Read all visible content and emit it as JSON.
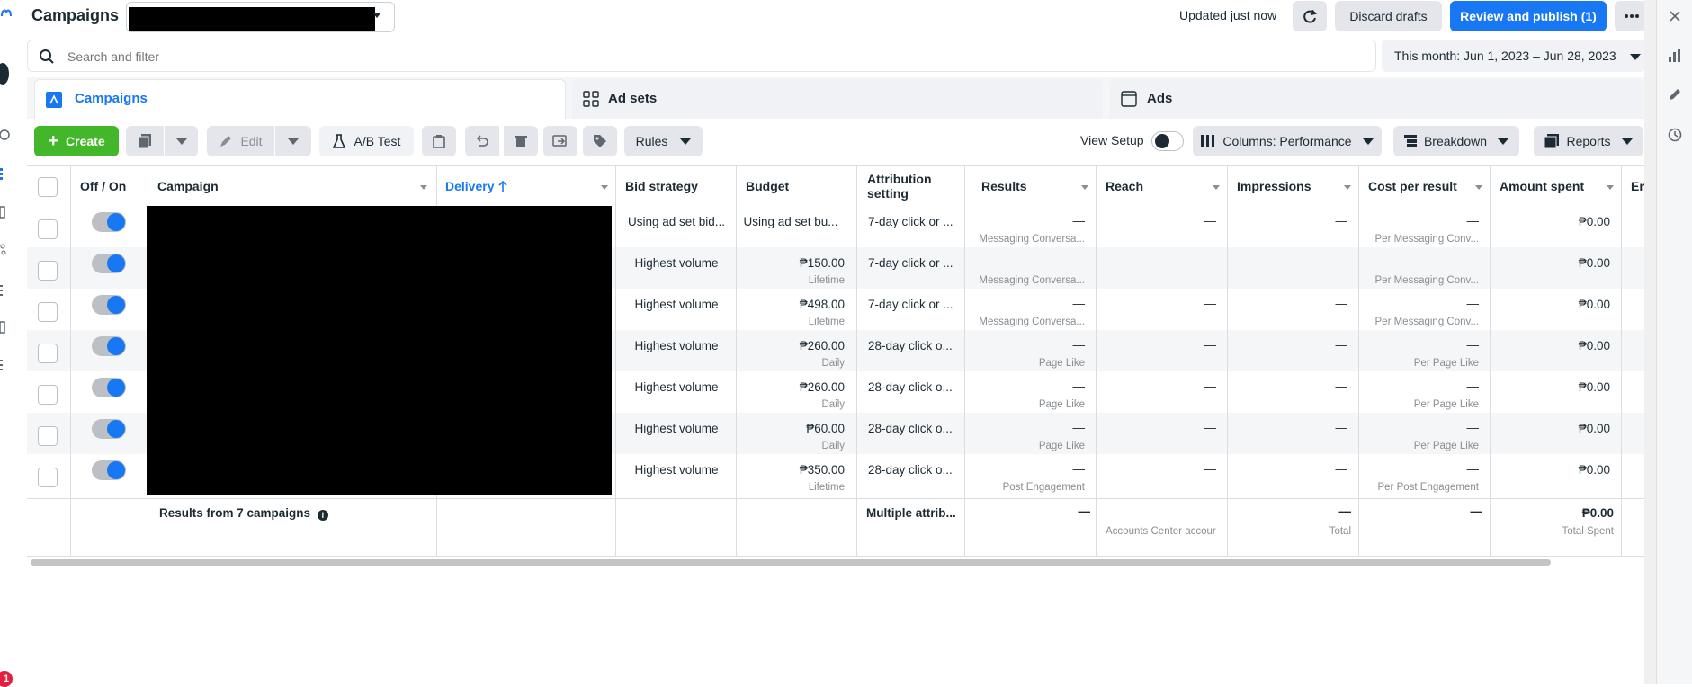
{
  "header": {
    "title": "Campaigns",
    "updated_text": "Updated just now",
    "discard_label": "Discard drafts",
    "publish_label": "Review and publish (1)"
  },
  "search": {
    "placeholder": "Search and filter"
  },
  "date_range": "This month: Jun 1, 2023 – Jun 28, 2023",
  "tabs": [
    {
      "label": "Campaigns",
      "active": true
    },
    {
      "label": "Ad sets",
      "active": false
    },
    {
      "label": "Ads",
      "active": false
    }
  ],
  "toolbar": {
    "create_label": "Create",
    "edit_label": "Edit",
    "ab_test_label": "A/B Test",
    "rules_label": "Rules",
    "view_setup_label": "View Setup",
    "columns_label": "Columns: Performance",
    "breakdown_label": "Breakdown",
    "reports_label": "Reports"
  },
  "columns": {
    "off_on": "Off / On",
    "campaign": "Campaign",
    "delivery": "Delivery",
    "bid_strategy": "Bid strategy",
    "budget": "Budget",
    "attribution": "Attribution setting",
    "results": "Results",
    "reach": "Reach",
    "impressions": "Impressions",
    "cost_per_result": "Cost per result",
    "amount_spent": "Amount spent",
    "ends": "End"
  },
  "rows": [
    {
      "bid": "Using ad set bid...",
      "budget": "Using ad set bu...",
      "budget_sub": "",
      "attribution": "7-day click or ...",
      "results": "—",
      "results_sub": "Messaging Conversa...",
      "reach": "—",
      "impressions": "—",
      "cpr": "—",
      "cpr_sub": "Per Messaging Conv...",
      "spent": "₱0.00"
    },
    {
      "bid": "Highest volume",
      "budget": "₱150.00",
      "budget_sub": "Lifetime",
      "attribution": "7-day click or ...",
      "results": "—",
      "results_sub": "Messaging Conversa...",
      "reach": "—",
      "impressions": "—",
      "cpr": "—",
      "cpr_sub": "Per Messaging Conv...",
      "spent": "₱0.00"
    },
    {
      "bid": "Highest volume",
      "budget": "₱498.00",
      "budget_sub": "Lifetime",
      "attribution": "7-day click or ...",
      "results": "—",
      "results_sub": "Messaging Conversa...",
      "reach": "—",
      "impressions": "—",
      "cpr": "—",
      "cpr_sub": "Per Messaging Conv...",
      "spent": "₱0.00"
    },
    {
      "bid": "Highest volume",
      "budget": "₱260.00",
      "budget_sub": "Daily",
      "attribution": "28-day click o...",
      "results": "—",
      "results_sub": "Page Like",
      "reach": "—",
      "impressions": "—",
      "cpr": "—",
      "cpr_sub": "Per Page Like",
      "spent": "₱0.00"
    },
    {
      "bid": "Highest volume",
      "budget": "₱260.00",
      "budget_sub": "Daily",
      "attribution": "28-day click o...",
      "results": "—",
      "results_sub": "Page Like",
      "reach": "—",
      "impressions": "—",
      "cpr": "—",
      "cpr_sub": "Per Page Like",
      "spent": "₱0.00"
    },
    {
      "bid": "Highest volume",
      "budget": "₱60.00",
      "budget_sub": "Daily",
      "attribution": "28-day click o...",
      "results": "—",
      "results_sub": "Page Like",
      "reach": "—",
      "impressions": "—",
      "cpr": "—",
      "cpr_sub": "Per Page Like",
      "spent": "₱0.00"
    },
    {
      "bid": "Highest volume",
      "budget": "₱350.00",
      "budget_sub": "Lifetime",
      "attribution": "28-day click o...",
      "results": "—",
      "results_sub": "Post Engagement",
      "reach": "—",
      "impressions": "—",
      "cpr": "—",
      "cpr_sub": "Per Post Engagement",
      "spent": "₱0.00"
    }
  ],
  "summary": {
    "label": "Results from 7 campaigns",
    "attribution": "Multiple attrib...",
    "results": "—",
    "reach_sub": "Accounts Center accour",
    "impressions": "—",
    "impressions_sub": "Total",
    "cpr": "—",
    "spent": "₱0.00",
    "spent_sub": "Total Spent"
  },
  "notification_badge": "1",
  "colors": {
    "accent": "#1877f2",
    "create": "#42b72a",
    "redaction": "#000000"
  }
}
